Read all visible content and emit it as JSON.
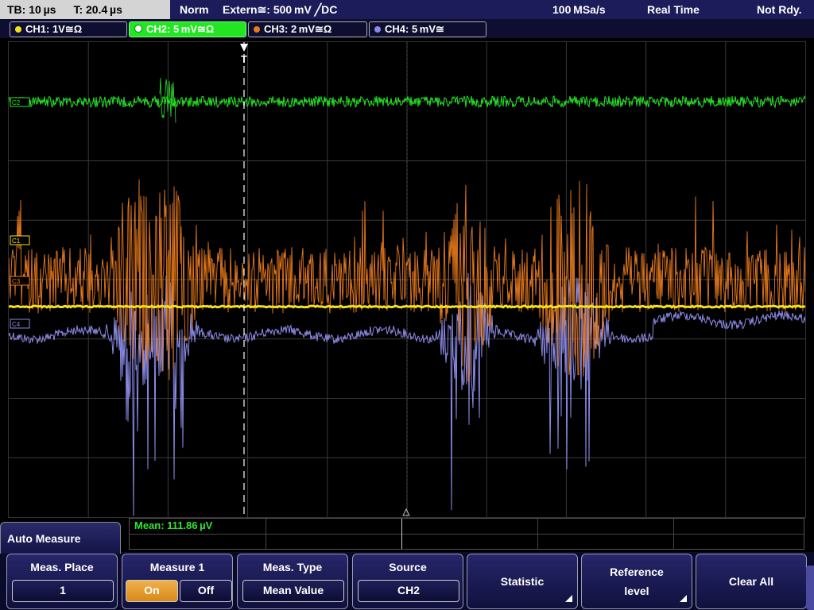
{
  "status": {
    "timebase": "TB: 10 µs",
    "trigger_time": "T: 20.4 µs",
    "mode": "Norm",
    "trigger": "Extern≅: 500 mV ╱DC",
    "sample_rate": "100 MSa/s",
    "acq_mode": "Real Time",
    "state": "Not Rdy."
  },
  "channels": [
    {
      "label": "CH1: 1V≅Ω",
      "color": "#f5e11a"
    },
    {
      "label": "CH2: 5 mV≅Ω",
      "color": "#22e622"
    },
    {
      "label": "CH3: 2 mV≅Ω",
      "color": "#e87a1c"
    },
    {
      "label": "CH4: 5 mV≅",
      "color": "#8a8ae6"
    }
  ],
  "markers": {
    "c1": "C1",
    "c2": "C2",
    "c3": "C3",
    "c4": "C4",
    "trigger": "T"
  },
  "measurement": {
    "readout": "Mean: 111.86 µV"
  },
  "menu": {
    "title": "Auto Measure",
    "meas_place": {
      "label": "Meas. Place",
      "value": "1"
    },
    "measure1": {
      "label": "Measure 1",
      "on": "On",
      "off": "Off",
      "selected": "On"
    },
    "meas_type": {
      "label": "Meas. Type",
      "value": "Mean Value"
    },
    "source": {
      "label": "Source",
      "value": "CH2"
    },
    "statistic": {
      "label": "Statistic"
    },
    "reference": {
      "label_line1": "Reference",
      "label_line2": "level"
    },
    "clear_all": {
      "label": "Clear All"
    }
  }
}
